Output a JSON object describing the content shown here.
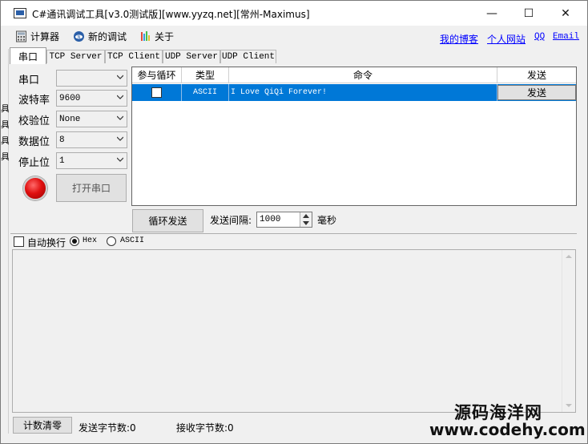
{
  "window": {
    "title": "C#通讯调试工具[v3.0测试版][www.yyzq.net][常州-Maximus]",
    "minimize_glyph": "—",
    "maximize_glyph": "☐",
    "close_glyph": "✕"
  },
  "menu": {
    "items": [
      {
        "label": "计算器",
        "icon": "calculator-icon"
      },
      {
        "label": "新的调试",
        "icon": "new-debug-icon"
      },
      {
        "label": "关于",
        "icon": "about-icon"
      }
    ],
    "links": [
      {
        "label": "我的博客"
      },
      {
        "label": "个人网站"
      },
      {
        "label": "QQ"
      },
      {
        "label": "Email"
      }
    ]
  },
  "tabs": [
    {
      "label": "串口",
      "active": true
    },
    {
      "label": "TCP Server"
    },
    {
      "label": "TCP Client"
    },
    {
      "label": "UDP Server"
    },
    {
      "label": "UDP Client"
    }
  ],
  "left_strip": [
    "具",
    "具",
    "具",
    "具"
  ],
  "serial": {
    "port_label": "串口",
    "port_value": "",
    "baud_label": "波特率",
    "baud_value": "9600",
    "parity_label": "校验位",
    "parity_value": "None",
    "databits_label": "数据位",
    "databits_value": "8",
    "stopbits_label": "停止位",
    "stopbits_value": "1",
    "open_button": "打开串口",
    "status_color": "#e01010"
  },
  "grid": {
    "headers": [
      "参与循环",
      "类型",
      "命令",
      "发送"
    ],
    "rows": [
      {
        "loop": false,
        "type": "ASCII",
        "command": "I Love QiQi Forever!",
        "send_label": "发送"
      }
    ],
    "selection_color": "#0078d7"
  },
  "loop_send": {
    "button": "循环发送",
    "interval_label": "发送间隔:",
    "interval_value": "1000",
    "unit": "毫秒"
  },
  "receive": {
    "autowrap_label": "自动换行",
    "autowrap_checked": false,
    "hex_label": "Hex",
    "ascii_label": "ASCII",
    "format_selected": "Hex"
  },
  "footer": {
    "reset_button": "计数清零",
    "sent_label": "发送字节数:0",
    "recv_label": "接收字节数:0"
  },
  "watermark": {
    "line1": "源码海洋网",
    "line2": "www.codehy.com"
  }
}
